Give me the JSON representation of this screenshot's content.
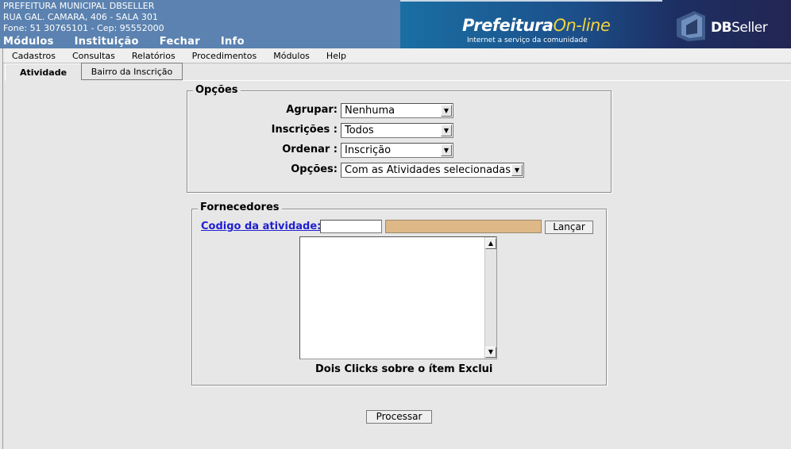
{
  "header": {
    "org_name": "PREFEITURA MUNICIPAL DBSELLER",
    "address": "RUA GAL. CAMARA, 406 - SALA 301",
    "contact": "Fone: 51 30765101  -  Cep: 95552000",
    "top_menu": [
      "Módulos",
      "Instituição",
      "Fechar",
      "Info"
    ],
    "banner_logo_main": "Prefeitura",
    "banner_logo_accent": "On-line",
    "banner_tagline": "Internet a serviço da comunidade",
    "brand_db": "DB",
    "brand_seller": "Seller"
  },
  "menubar": {
    "items": [
      "Cadastros",
      "Consultas",
      "Relatórios",
      "Procedimentos",
      "Módulos",
      "Help"
    ]
  },
  "tabs": [
    {
      "label": "Atividade",
      "active": true
    },
    {
      "label": "Bairro da Inscrição",
      "active": false
    }
  ],
  "opcoes": {
    "legend": "Opções",
    "rows": [
      {
        "label": "Agrupar:",
        "value": "Nenhuma"
      },
      {
        "label": "Inscrições :",
        "value": "Todos"
      },
      {
        "label": "Ordenar :",
        "value": "Inscrição"
      },
      {
        "label": "Opções:",
        "value": "Com as Atividades selecionadas"
      }
    ]
  },
  "fornecedores": {
    "legend": "Fornecedores",
    "codigo_label": "Codigo da atividade:",
    "codigo_value": "",
    "descricao_value": "",
    "lancar_label": "Lançar",
    "list_items": [],
    "hint": "Dois Clicks sobre o ítem Exclui"
  },
  "processar_label": "Processar",
  "colors": {
    "header_bg": "#5b82b0",
    "readonly_field": "#deb887",
    "link": "#1f1fd1",
    "page_bg": "#e7e7e7"
  }
}
